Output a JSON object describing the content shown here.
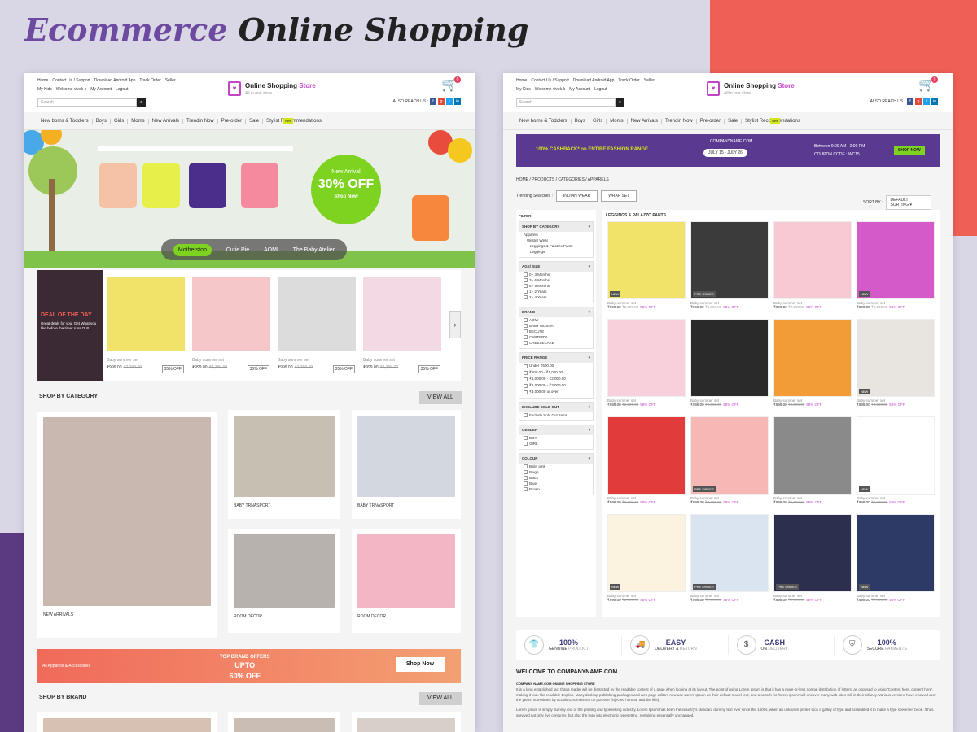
{
  "title": {
    "part1": "Ecommerce",
    "part2": "Online Shopping"
  },
  "header": {
    "links_row1": [
      "Home",
      "Contact Us / Support",
      "Download Android App"
    ],
    "links_row2": [
      "Track Order",
      "Seller",
      "My Kids",
      "Welcome vivek k",
      "My Account",
      "Logout"
    ],
    "search_placeholder": "Search",
    "logo_title": "Online Shopping",
    "logo_title_accent": "Store",
    "logo_tagline": "All in one store",
    "reach_label": "ALSO REACH US :",
    "cart_count": "0"
  },
  "nav": {
    "items": [
      "New borns & Toddlers",
      "Boys",
      "Girls",
      "Moms",
      "New Arrivals",
      "Trendin Now",
      "Pre-order",
      "Sale",
      "Stylist Recommendations"
    ],
    "new_tag": "New"
  },
  "home": {
    "offer": {
      "line1": "New Arrival",
      "line2": "30% OFF",
      "line3": "Shop Now"
    },
    "brand_pills": [
      "Motherstop",
      "Cutie Pie",
      "AOMI",
      "The Baby Atelier"
    ],
    "deal": {
      "title": "DEAL OF THE DAY",
      "text": "Great deals for you. Get What you like before the timer runs Out!"
    },
    "deal_products": [
      {
        "name": "Baby summer set",
        "price": "₹999.00",
        "old": "₹2,399.00",
        "off": "35% OFF"
      },
      {
        "name": "Baby summer set",
        "price": "₹999.00",
        "old": "₹2,399.00",
        "off": "35% OFF"
      },
      {
        "name": "Baby summer set",
        "price": "₹999.00",
        "old": "₹2,399.00",
        "off": "35% OFF"
      },
      {
        "name": "Baby summer set",
        "price": "₹999.00",
        "old": "₹2,399.00",
        "off": "35% OFF"
      }
    ],
    "shop_by_category": "SHOP BY CATEGORY",
    "view_all": "VIEW ALL",
    "categories": [
      "NEW ARRIVALS",
      "BABY TRNASPORT",
      "BABY TRNASPORT",
      "ROOM DECOR",
      "ROOM DECOR"
    ],
    "promo": {
      "left": "All Apparels & Accessories",
      "top": "TOP BRAND OFFERS",
      "mid": "UPTO",
      "big": "60% OFF",
      "button": "Shop Now"
    },
    "shop_by_brand": "SHOP BY BRAND"
  },
  "listing": {
    "banner": {
      "cashback": "100% CASHBACK* on ENTIRE FASHION RANGE",
      "company": "COMPANYNAME.COM",
      "dates": "JULY 15 - JULY 26",
      "time": "Between 9:00 AM - 2:00 PM",
      "coupon": "COUPON CODE : WC15",
      "button": "SHOP NOW"
    },
    "breadcrumb": "HOME / PRODUCTS / CATEGORIES / APPARELS",
    "trending_label": "Trending Searches :",
    "trending": [
      "INDIAN WEAR",
      "WRAP SET"
    ],
    "sort_label": "SORT BY :",
    "sort_value": "DEFAULT SORTING",
    "filter_title": "FILTER",
    "filters": [
      {
        "title": "SHOP BY CATEGORY",
        "options": [
          "Apparels",
          "Wester Wear",
          "Leggings & Palazzo Pants",
          "Leggings"
        ],
        "checkbox": false
      },
      {
        "title": "AGE/ SIZE",
        "options": [
          "0 - 3 Months",
          "3 - 6 Months",
          "6 - 9 Months",
          "1 - 2 Years",
          "2 - 4 Years"
        ],
        "checkbox": true
      },
      {
        "title": "BRAND",
        "options": [
          "AOMI",
          "BABY MOSHAI",
          "BECUTE",
          "CARTER'S",
          "CHEESECAKE"
        ],
        "checkbox": true
      },
      {
        "title": "PRICE RANGE",
        "options": [
          "Under ₹500.00",
          "₹500.00 - ₹1,000.00",
          "₹1,000.00 - ₹2,000.00",
          "₹2,000.00 - ₹3,000.00",
          "₹3,000.00 or over"
        ],
        "checkbox": true
      },
      {
        "title": "EXCLUDE SOLD OUT",
        "options": [
          "Exclude Sold Out Items"
        ],
        "checkbox": true
      },
      {
        "title": "GENDER",
        "options": [
          "BOY",
          "GIRL"
        ],
        "checkbox": true
      },
      {
        "title": "COLOUR",
        "options": [
          "Baby pink",
          "Beige",
          "Black",
          "Blue",
          "Brown"
        ],
        "checkbox": true
      }
    ],
    "grid_title": "LEGGINGS & PALAZZO PANTS",
    "product": {
      "name": "Baby summer set",
      "price": "₹999.00",
      "old": "₹2,099.00",
      "off": "58% OFF"
    },
    "tags": [
      "NEW",
      "PRE ORDER",
      "",
      "NEW",
      "",
      "",
      "",
      "NEW",
      "",
      "PRE ORDER",
      "",
      "NEW",
      "NEW",
      "PRE ORDER",
      "PRE ORDER",
      "NEW"
    ],
    "features": [
      {
        "big": "100%",
        "small1": "GENUINE",
        "small2": "PRODUCT"
      },
      {
        "big": "EASY",
        "small1": "DELIVERY &",
        "small2": "RETURN"
      },
      {
        "big": "CASH",
        "small1": "ON",
        "small2": "DELIVERY"
      },
      {
        "big": "100%",
        "small1": "SECURE",
        "small2": "PAYMENTS"
      }
    ],
    "welcome_title": "WELCOME TO COMPANYNAME.COM",
    "welcome_sub": "COMPANY NAME.COM ONLINE SHOPPING STORE",
    "welcome_p1": "It is a long established fact that a reader will be distracted by the readable content of a page when looking at its layout. The point of using Lorem Ipsum is that it has a more-or-less normal distribution of letters, as opposed to using 'Content here, content here', making it look like readable English. Many desktop publishing packages and web page editors now use Lorem Ipsum as their default model text, and a search for 'lorem ipsum' will uncover many web sites still in their infancy. Various versions have evolved over the years, sometimes by accident, sometimes on purpose (injected humour and the like).",
    "welcome_p2": "Lorem Ipsum is simply dummy text of the printing and typesetting industry. Lorem Ipsum has been the industry's standard dummy text ever since the 1500s, when an unknown printer took a galley of type and scrambled it to make a type specimen book. It has survived not only five centuries, but also the leap into electronic typesetting, remaining essentially unchanged."
  },
  "colors": {
    "accent": "#c244c9",
    "green": "#7ed321",
    "coral": "#f05f55",
    "purple": "#5a3a91"
  }
}
